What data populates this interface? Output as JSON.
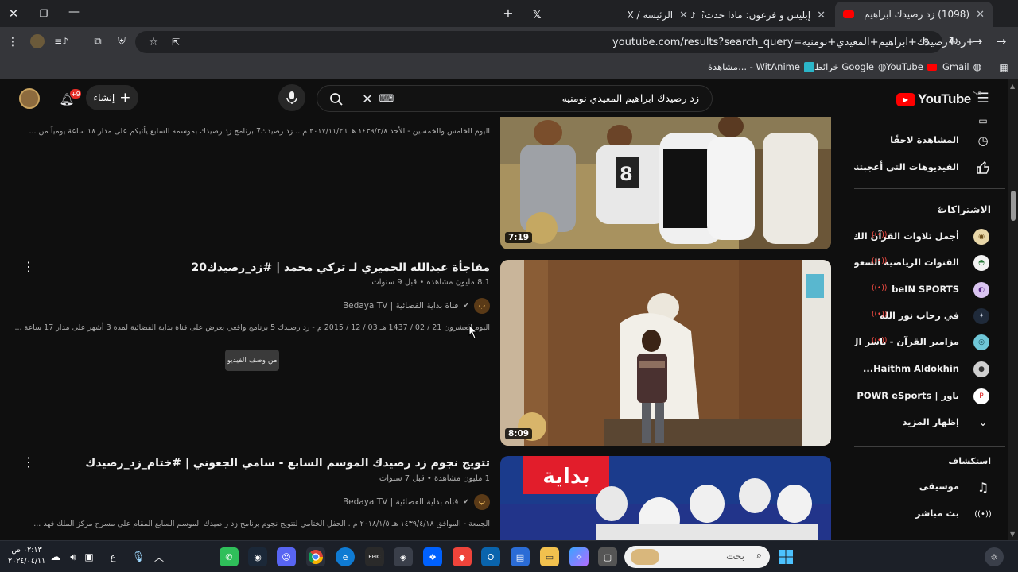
{
  "browser": {
    "tabs": [
      {
        "title": "(1098) زد رصيدك ابراهيم المعيدي",
        "active": true
      },
      {
        "title": "إبليس و فرعون: ماذا حدث؟ | TikTok",
        "active": false
      },
      {
        "title": "الرئيسة / X",
        "active": false
      }
    ],
    "url": "youtube.com/results?search_query=زد+رصيدك+ابراهيم+المعيدي+نومنيه+",
    "bookmarks": [
      {
        "label": "Gmail",
        "icon": "gmail-icon"
      },
      {
        "label": "YouTube",
        "icon": "youtube-icon"
      },
      {
        "label": "خرائط Google",
        "icon": "maps-icon"
      },
      {
        "label": "مشاهدة... - WitAnime",
        "icon": "witanime-icon"
      }
    ]
  },
  "youtube": {
    "logo_text": "YouTube",
    "region": "SA",
    "search_query": "زد رصيدك ابراهيم المعيدي نومنيه",
    "create_label": "إنشاء",
    "notification_badge": "+9"
  },
  "sidebar": {
    "top_items": [
      {
        "label": "المشاهدة لاحقًا",
        "icon": "clock-icon"
      },
      {
        "label": "الفيديوهات التي أعجبتني",
        "icon": "thumbs-up-icon"
      }
    ],
    "subscriptions_title": "الاشتراكات",
    "subscriptions": [
      {
        "label": "أجمل تلاوات القرآن الك...",
        "live": true
      },
      {
        "label": "القنوات الرياضية السعو...",
        "live": true
      },
      {
        "label": "beIN SPORTS",
        "live": true
      },
      {
        "label": "في رحاب نور الله",
        "live": true
      },
      {
        "label": "مزامير القرآن - ياسر ال...",
        "live": true
      },
      {
        "label": "Haithm Aldokhin...",
        "live": false
      },
      {
        "label": "باور | POWR eSports",
        "live": false
      }
    ],
    "show_more": "إظهار المزيد",
    "explore_title": "استكشاف",
    "explore": [
      {
        "label": "موسيقى",
        "icon": "music-icon"
      },
      {
        "label": "بث مباشر",
        "icon": "live-icon"
      }
    ]
  },
  "results": [
    {
      "title": "",
      "duration": "7:19",
      "description": "اليوم الخامس والخمسين - الأحد ١٤٣٩/٣/٨ هـ ٢٠١٧/١١/٢٦ م .. زد رصيدك7 برنامج زد رصيدك بموسمه السابع يأتيكم على مدار ١٨ ساعة يومياً من ..."
    },
    {
      "title": "مفاجأة عبدالله الجميري لـ تركي محمد | #زد_رصيدك20",
      "meta": "8.1 مليون مشاهدة • قبل 9 سنوات",
      "channel": "قناة بداية الفضائية | Bedaya TV",
      "duration": "8:09",
      "description": "اليوم العشرون 21 / 02 / 1437 هـ 03 / 12 / 2015 م - زد رصيدك 5 برنامج واقعي يعرض على قناة بداية الفضائية لمدة 3 أشهر على مدار 17 ساعة ...",
      "from_description_label": "من وصف الفيديو"
    },
    {
      "title": "تتويج نجوم زد رصيدك الموسم السابع - سامي الجعوني | #ختام_زد_رصيدك",
      "meta": "1 مليون مشاهدة • قبل 7 سنوات",
      "channel": "قناة بداية الفضائية | Bedaya TV",
      "description": "الجمعة - الموافق ١٤٣٩/٤/١٨ هـ ٢٠١٨/١/٥ م . الحفل الختامي لتتويج نجوم برنامج زد ر صيدك الموسم السابع المقام على مسرح مركز الملك فهد ...",
      "thumb_logo": "بداية"
    }
  ],
  "taskbar": {
    "search_placeholder": "بحث",
    "time": "٠٢:١٣ ص",
    "date": "٢٠٢٤/٠٤/١١",
    "lang": "ع",
    "apps": [
      "chrome",
      "edge",
      "epic-games",
      "dropbox",
      "anydesk",
      "outlook",
      "store",
      "file-explorer",
      "copilot",
      "discord",
      "steam",
      "whatsapp"
    ]
  }
}
